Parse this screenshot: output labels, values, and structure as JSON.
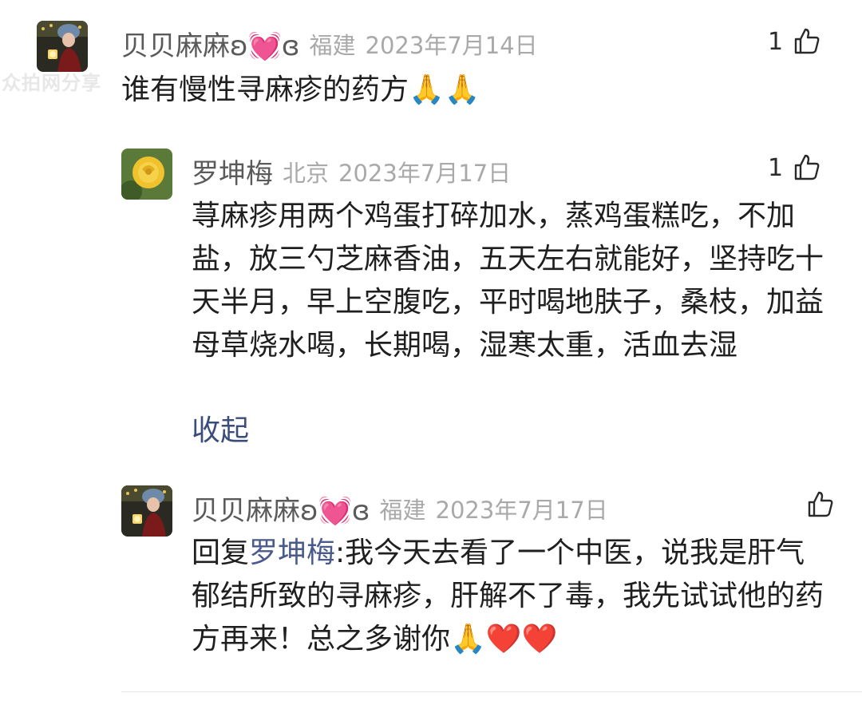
{
  "watermark": "众拍网分享",
  "comments": [
    {
      "author": "贝贝麻麻ʚ💓ɞ",
      "location": "福建",
      "date": "2023年7月14日",
      "like_count": "1",
      "text": "谁有慢性寻麻疹的药方🙏🙏"
    },
    {
      "author": "罗坤梅",
      "location": "北京",
      "date": "2023年7月17日",
      "like_count": "1",
      "text": "荨麻疹用两个鸡蛋打碎加水，蒸鸡蛋糕吃，不加盐，放三勺芝麻香油，五天左右就能好，坚持吃十天半月，早上空腹吃，平时喝地肤子，桑枝，加益母草烧水喝，长期喝，湿寒太重，活血去湿",
      "collapse_label": "收起"
    },
    {
      "author": "贝贝麻麻ʚ💓ɞ",
      "location": "福建",
      "date": "2023年7月17日",
      "like_count": "",
      "reply_prefix": "回复",
      "reply_to": "罗坤梅",
      "text": ":我今天去看了一个中医，说我是肝气郁结所致的寻麻疹，肝解不了毒，我先试试他的药方再来！总之多谢你🙏❤️❤️"
    }
  ],
  "icons": {
    "thumb": "thumbs-up-outline-icon",
    "avatar_1": "woman-in-headdress-avatar",
    "avatar_2": "yellow-rose-avatar"
  },
  "colors": {
    "author": "#5a5a5a",
    "meta": "#a9a9a9",
    "mention": "#4a5a8c",
    "collapse": "#3b4d7a"
  }
}
